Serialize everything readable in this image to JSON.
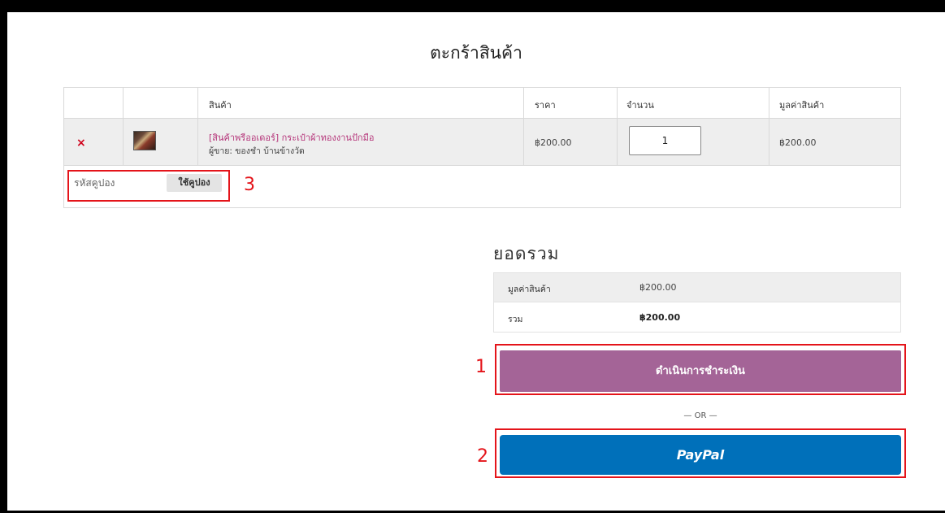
{
  "page": {
    "title": "ตะกร้าสินค้า"
  },
  "cart": {
    "headers": {
      "product": "สินค้า",
      "price": "ราคา",
      "quantity": "จำนวน",
      "subtotal": "มูลค่าสินค้า"
    },
    "item": {
      "remove": "×",
      "name": "[สินค้าพรีออเดอร์] กระเป๋าผ้าทองงานปักมือ",
      "seller": "ผู้ขาย: ของชำ บ้านข้างวัด",
      "price": "฿200.00",
      "quantity": "1",
      "subtotal": "฿200.00"
    },
    "coupon": {
      "placeholder": "รหัสคูปอง",
      "apply_label": "ใช้คูปอง"
    }
  },
  "totals": {
    "title": "ยอดรวม",
    "subtotal_label": "มูลค่าสินค้า",
    "subtotal_value": "฿200.00",
    "total_label": "รวม",
    "total_value": "฿200.00"
  },
  "checkout": {
    "label": "ดำเนินการชำระเงิน"
  },
  "or_separator": "— OR —",
  "paypal": {
    "label": "PayPal"
  },
  "callouts": {
    "one": "1",
    "two": "2",
    "three": "3"
  },
  "colors": {
    "accent": "#a46497",
    "paypal": "#0070ba",
    "callout": "#e4141a",
    "link": "#b5357a"
  }
}
